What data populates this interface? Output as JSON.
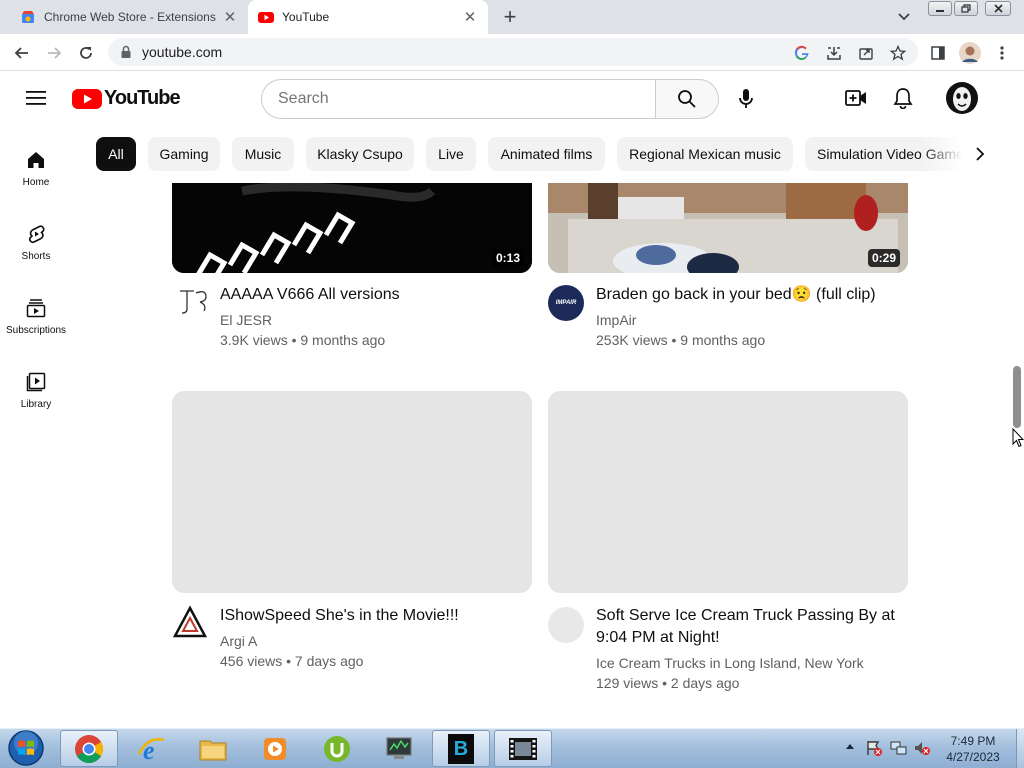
{
  "browser": {
    "tabs": [
      {
        "title": "Chrome Web Store - Extensions",
        "icon": "chrome-web-store-icon",
        "active": false
      },
      {
        "title": "YouTube",
        "icon": "youtube-icon",
        "active": true
      }
    ],
    "new_tab_label": "+",
    "url": "youtube.com"
  },
  "youtube": {
    "logo_text": "YouTube",
    "search": {
      "placeholder": "Search"
    },
    "brand_color": "#ff0000",
    "chips": [
      "All",
      "Gaming",
      "Music",
      "Klasky Csupo",
      "Live",
      "Animated films",
      "Regional Mexican music",
      "Simulation Video Games"
    ],
    "active_chip": "All",
    "sidebar": [
      {
        "label": "Home",
        "icon": "home-icon"
      },
      {
        "label": "Shorts",
        "icon": "shorts-icon"
      },
      {
        "label": "Subscriptions",
        "icon": "subscriptions-icon"
      },
      {
        "label": "Library",
        "icon": "library-icon"
      }
    ],
    "videos": [
      {
        "title": "AAAAA V666 All versions",
        "channel": "El JESR",
        "meta": "3.9K views • 9 months ago",
        "duration": "0:13"
      },
      {
        "title": "Braden go back in your bed😟 (full clip)",
        "channel": "ImpAir",
        "meta": "253K views • 9 months ago",
        "duration": "0:29",
        "avatar_text": "IMPAIR"
      },
      {
        "title": "IShowSpeed She's in the Movie!!!",
        "channel": "Argi A",
        "meta": "456 views • 7 days ago"
      },
      {
        "title": "Soft Serve Ice Cream Truck Passing By at 9:04 PM at Night!",
        "channel": "Ice Cream Trucks in Long Island, New York",
        "meta": "129 views • 2 days ago"
      }
    ]
  },
  "taskbar": {
    "clock_time": "7:49 PM",
    "clock_date": "4/27/2023"
  }
}
